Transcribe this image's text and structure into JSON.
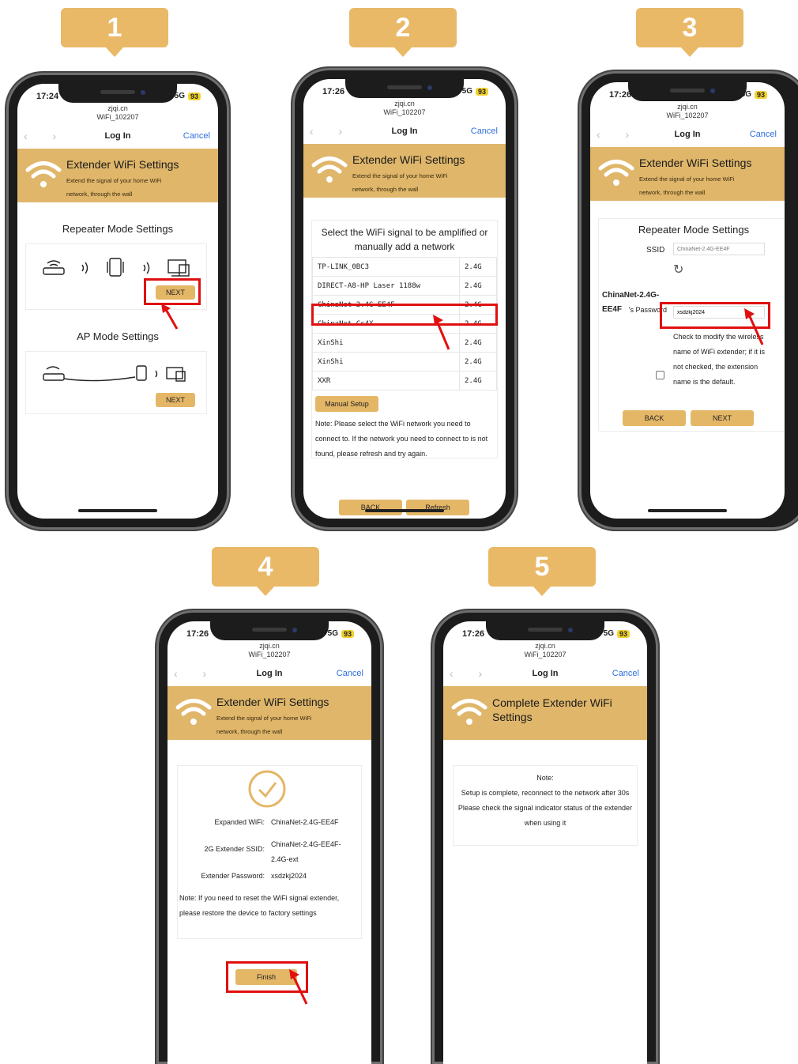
{
  "common": {
    "url": "zjqi.cn",
    "ssid_top": "WiFi_102207",
    "login": "Log In",
    "cancel": "Cancel",
    "signal": "5G",
    "battery": "93",
    "header_title": "Extender WiFi Settings",
    "header_sub": "Extend the signal of your home WiFi network, through the wall"
  },
  "steps": [
    "1",
    "2",
    "3",
    "4",
    "5"
  ],
  "s1": {
    "time": "17:24",
    "repeater_title": "Repeater Mode Settings",
    "next": "NEXT",
    "ap_title": "AP Mode Settings",
    "next2": "NEXT"
  },
  "s2": {
    "time": "17:26",
    "prompt": "Select the WiFi signal to be amplified or manually add a network",
    "networks": [
      {
        "name": "TP-LINK_0BC3",
        "band": "2.4G"
      },
      {
        "name": "DIRECT-A8-HP Laser 1188w",
        "band": "2.4G"
      },
      {
        "name": "ChinaNet-2.4G-EE4F",
        "band": "2.4G"
      },
      {
        "name": "ChinaNet-Cc4X",
        "band": "2.4G"
      },
      {
        "name": "XinShi",
        "band": "2.4G"
      },
      {
        "name": "XinShi",
        "band": "2.4G"
      },
      {
        "name": "XXR",
        "band": "2.4G"
      }
    ],
    "manual": "Manual Setup",
    "note": "Note: Please select the WiFi network you need to connect to. If the network you need to connect to is not found, please refresh and try again.",
    "back": "BACK",
    "refresh": "Refresh"
  },
  "s3": {
    "time": "17:26",
    "title": "Repeater Mode Settings",
    "ssid_label": "SSID",
    "ssid_placeholder": "ChinaNet-2.4G-EE4F",
    "net_name": "ChinaNet-2.4G-EE4F",
    "pw_suffix": "'s Password",
    "password": "xsdzkj2024",
    "check_text": "Check to modify the wireless name of WiFi extender; if it is not checked, the extension name is the default.",
    "back": "BACK",
    "next": "NEXT"
  },
  "s4": {
    "time": "17:26",
    "expanded_label": "Expanded WiFi:",
    "expanded_value": "ChinaNet-2.4G-EE4F",
    "ssid2g_label": "2G Extender SSID:",
    "ssid2g_value": "ChinaNet-2.4G-EE4F-2.4G-ext",
    "pw_label": "Extender Password:",
    "pw_value": "xsdzkj2024",
    "note": "Note: If you need to reset the WiFi signal extender, please restore the device to factory settings",
    "finish": "Finish"
  },
  "s5": {
    "time": "17:26",
    "header_title": "Complete Extender WiFi Settings",
    "note_title": "Note:",
    "line1": "Setup is complete, reconnect to the network after 30s",
    "line2": "Please check the signal indicator status of the extender when using it"
  },
  "colors": {
    "accent": "#e4b767",
    "header": "#dfb66a",
    "badge": "#e9b968",
    "highlight": "#e01010",
    "link": "#2f6fde"
  }
}
